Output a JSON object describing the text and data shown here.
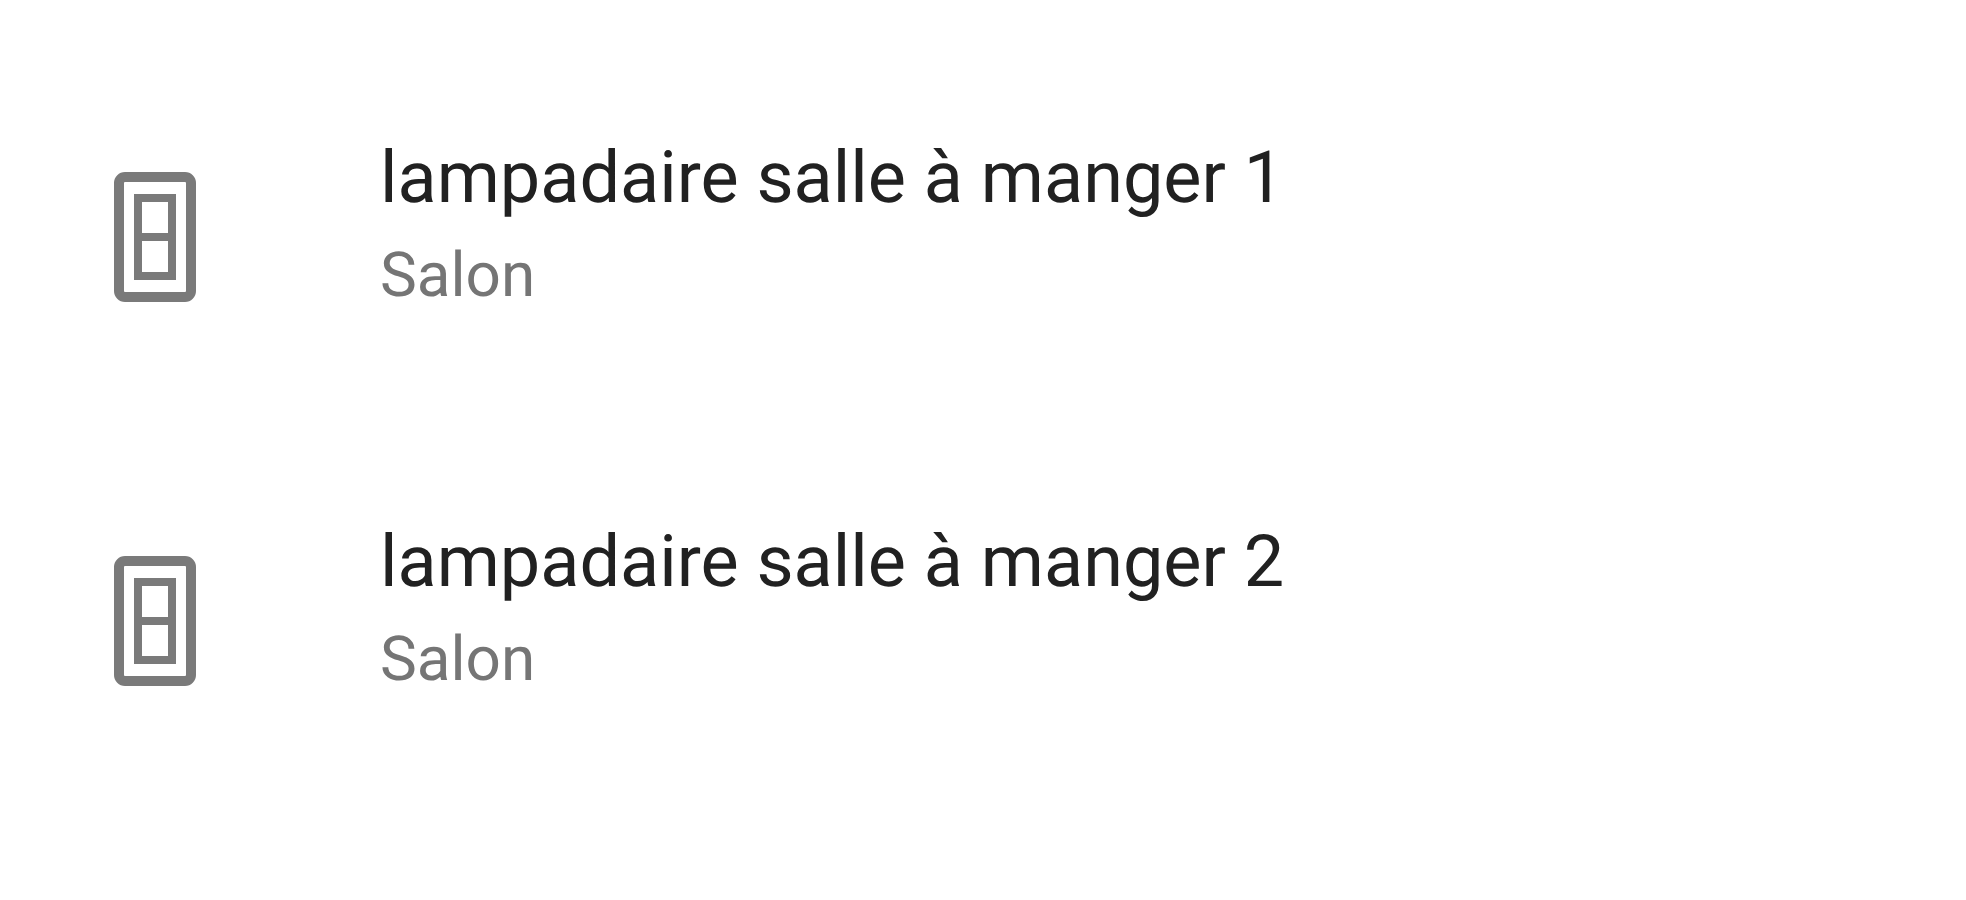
{
  "devices": [
    {
      "name": "lampadaire salle à manger 1",
      "room": "Salon"
    },
    {
      "name": "lampadaire salle à manger 2",
      "room": "Salon"
    }
  ]
}
